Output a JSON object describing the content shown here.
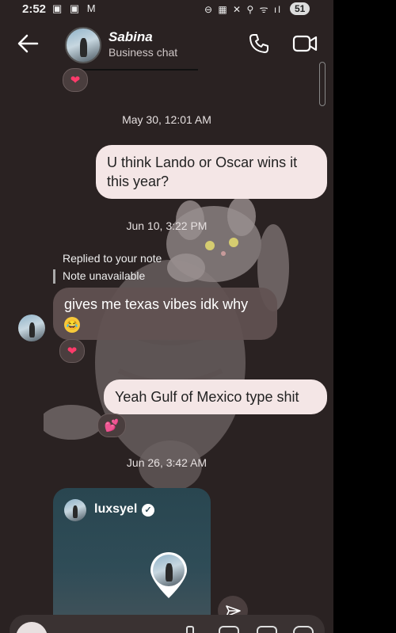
{
  "status_bar": {
    "time": "2:52",
    "left_icons": "▣ ▣ M",
    "right_icons": "⊖ ▦ ✕ ⚲ ᯤ ıl",
    "battery": "51"
  },
  "header": {
    "contact_name": "Sabina",
    "subtitle": "Business chat",
    "icons": [
      "back-arrow-icon",
      "phone-icon",
      "video-icon"
    ]
  },
  "messages": {
    "reaction_top": "❤",
    "ts1": "May 30, 12:01 AM",
    "out1": "U think Lando or Oscar wins it this year?",
    "ts2": "Jun 10, 3:22 PM",
    "reply_label": "Replied to your note",
    "reply_note": "Note unavailable",
    "in1": "gives me texas vibes idk why",
    "in1_emoji": "😂",
    "in1_reaction": "❤",
    "out2": "Yeah Gulf of Mexico type shit",
    "out2_reaction": "💕",
    "ts3": "Jun 26, 3:42 AM"
  },
  "shared_post": {
    "username": "luxsyel",
    "verified": "✓"
  },
  "colors": {
    "background": "#2a2222",
    "outgoing_bubble": "#f4e6e6",
    "incoming_bubble": "#625252",
    "heart": "#ff3b6b"
  }
}
